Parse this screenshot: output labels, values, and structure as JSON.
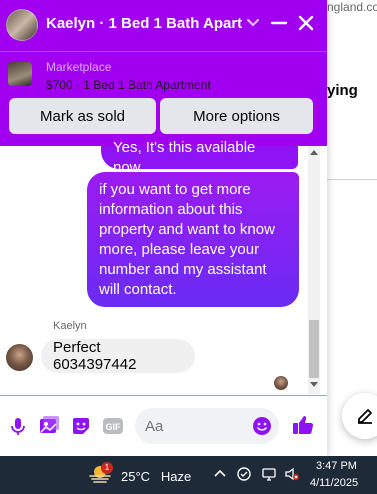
{
  "background": {
    "url_fragment": "ngland.com",
    "text_fragment": "ying"
  },
  "chat": {
    "header": {
      "title": "Kaelyn · 1 Bed 1 Bath Apart",
      "icons": [
        "chevron-down-icon",
        "minimize-icon",
        "close-icon"
      ]
    },
    "marketplace": {
      "label": "Marketplace",
      "listing": "$700 · 1 Bed 1 Bath Apartment"
    },
    "buttons": {
      "mark_sold": "Mark as sold",
      "more_options": "More options"
    },
    "messages": [
      {
        "direction": "outgoing",
        "text": "Yes, It's this available now."
      },
      {
        "direction": "outgoing",
        "text": "if you want to get more information about this property and want to know more, please leave your number and my assistant will contact."
      },
      {
        "direction": "incoming",
        "sender": "Kaelyn",
        "text": "Perfect 6034397442"
      }
    ],
    "composer": {
      "placeholder": "Aa",
      "icons": [
        "microphone-icon",
        "photo-icon",
        "sticker-icon",
        "gif-icon",
        "emoji-icon",
        "like-icon"
      ]
    }
  },
  "taskbar": {
    "weather": {
      "temp": "25°C",
      "condition": "Haze",
      "badge": "1"
    },
    "clock": {
      "time": "3:47 PM",
      "date": "4/11/2025"
    }
  },
  "colors": {
    "header": "#a100f0",
    "outgoing_bubble": "#8f14f5",
    "incoming_bubble": "#f0f0f0",
    "accent": "#8f14f5",
    "taskbar": "#1e2a38"
  }
}
